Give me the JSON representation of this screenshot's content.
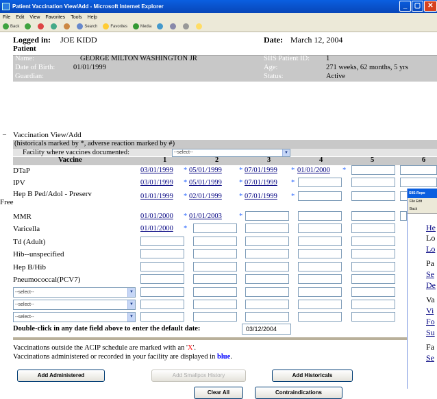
{
  "window": {
    "title": "Patient Vaccination View/Add - Microsoft Internet Explorer",
    "menu": [
      "File",
      "Edit",
      "View",
      "Favorites",
      "Tools",
      "Help"
    ],
    "toolbar": [
      "Back",
      "Search",
      "Favorites",
      "Media"
    ]
  },
  "header": {
    "logged_in_label": "Logged in:",
    "logged_in_user": "JOE KIDD",
    "date_label": "Date:",
    "date_value": "March 12, 2004",
    "section_patient": "Patient"
  },
  "patient": {
    "name_label": "Name:",
    "name_value": "GEORGE MILTON WASHINGTON JR",
    "siis_label": "SIIS Patient ID:",
    "siis_value": "1",
    "dob_label": "Date of Birth:",
    "dob_value": "01/01/1999",
    "age_label": "Age:",
    "age_value": "271 weeks, 62 months, 5 yrs",
    "guardian_label": "Guardian:",
    "status_label": "Status:",
    "status_value": "Active"
  },
  "vaccination": {
    "section_title": "Vaccination View/Add",
    "legend": "(historicals marked by *, adverse reaction marked by #)",
    "facility_label": "Facility where vaccines documented:",
    "facility_selected": "--select--",
    "col_vaccine": "Vaccine",
    "columns": [
      "1",
      "2",
      "3",
      "4",
      "5",
      "6"
    ],
    "rows": [
      {
        "name": "DTaP",
        "dates": [
          "03/01/1999",
          "05/01/1999",
          "07/01/1999",
          "01/01/2000"
        ]
      },
      {
        "name": "IPV",
        "dates": [
          "03/01/1999",
          "05/01/1999",
          "07/01/1999"
        ]
      },
      {
        "name_line1": "Hep B Ped/Adol - Preserv",
        "name_line2": "Free",
        "dates": [
          "01/01/1999",
          "02/01/1999",
          "07/01/1999"
        ]
      },
      {
        "name": "MMR",
        "dates": [
          "01/01/2000",
          "01/01/2003"
        ]
      },
      {
        "name": "Varicella",
        "dates": [
          "01/01/2000"
        ]
      },
      {
        "name": "Td (Adult)",
        "dates": []
      },
      {
        "name": "Hib--unspecified",
        "dates": []
      },
      {
        "name": "Hep B/Hib",
        "dates": []
      },
      {
        "name": "Pneumococcal(PCV7)",
        "dates": []
      }
    ],
    "star": "*",
    "select_rows": [
      "--select--",
      "--select--",
      "--select--"
    ],
    "default_date_label": "Double-click in any date field above to enter the default date:",
    "default_date_value": "03/12/2004",
    "note1_prefix": "Vaccinations outside the ACIP schedule are marked with an '",
    "note1_x": "X",
    "note1_suffix": "'.",
    "note2_prefix": "Vaccinations administered or recorded in your facility are displayed in ",
    "note2_blue": "blue",
    "note2_suffix": "."
  },
  "buttons": {
    "add_administered": "Add Administered",
    "add_smallpox": "Add Smallpox History",
    "add_historicals": "Add Historicals",
    "clear_all": "Clear All",
    "contraindications": "Contraindications"
  },
  "popup": {
    "title": "SIIS-Repo",
    "menu": "File Edit",
    "toolbar": "Back",
    "items": [
      "He",
      "Lo",
      "Lo",
      "Pa",
      "Se",
      "De",
      "Va",
      "Vi",
      "Fo",
      "Su",
      "Fa",
      "Se"
    ]
  },
  "colors": {
    "titlebar": "#0846b8",
    "gray_header": "#c8c8c8",
    "link": "#000080",
    "historical_star": "#2060ff",
    "acip_x": "#ff0000",
    "facility_blue": "#0000ff"
  }
}
